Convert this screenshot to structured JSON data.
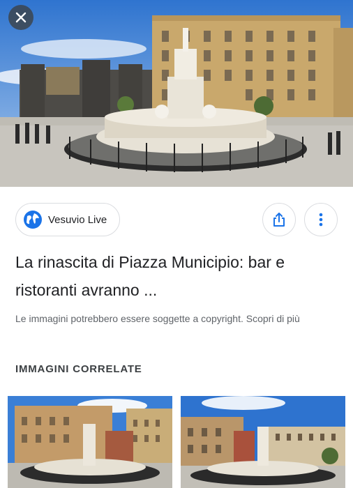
{
  "hero": {
    "alt": ""
  },
  "source": {
    "name": "Vesuvio Live"
  },
  "result": {
    "title": "La rinascita di Piazza Municipio: bar e ristoranti avranno ...",
    "copyright_notice": "Le immagini potrebbero essere soggette a copyright. Scopri di più"
  },
  "related": {
    "heading": "IMMAGINI CORRELATE"
  },
  "colors": {
    "accent": "#1a73e8",
    "sky": "#3f83d8",
    "building": "#c8a66a",
    "castle": "#4a4a48"
  },
  "icons": {
    "close": "close-icon",
    "globe": "globe-icon",
    "share": "share-icon",
    "more": "more-vert-icon"
  }
}
